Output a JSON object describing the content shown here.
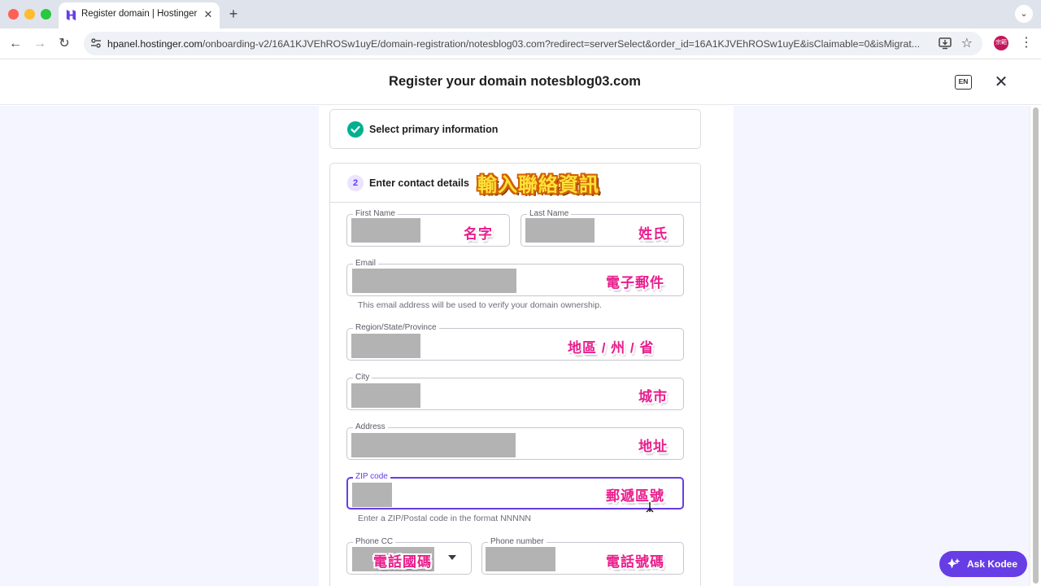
{
  "browser": {
    "tab_title": "Register domain | Hostinger",
    "tab_close": "✕",
    "new_tab": "+",
    "url_host": "hpanel.hostinger.com",
    "url_path": "/onboarding-v2/16A1KJVEhROSw1uyE/domain-registration/notesblog03.com?redirect=serverSelect&order_id=16A1KJVEhROSw1uyE&isClaimable=0&isMigrat...",
    "profile_initials": "宗範"
  },
  "header": {
    "title": "Register your domain notesblog03.com",
    "lang_label": "EN",
    "close_label": "✕"
  },
  "steps": {
    "step1": {
      "title": "Select primary information",
      "status": "complete"
    },
    "step2": {
      "number": "2",
      "title": "Enter contact details"
    }
  },
  "annotations": {
    "contact_details": "輸入聯絡資訊",
    "first_name": "名字",
    "last_name": "姓氏",
    "email": "電子郵件",
    "region": "地區 / 州 / 省",
    "city": "城市",
    "address": "地址",
    "zip": "郵遞區號",
    "phone_cc": "電話國碼",
    "phone_number": "電話號碼"
  },
  "form": {
    "first_name_label": "First Name",
    "last_name_label": "Last Name",
    "email_label": "Email",
    "email_hint": "This email address will be used to verify your domain ownership.",
    "region_label": "Region/State/Province",
    "city_label": "City",
    "address_label": "Address",
    "zip_label": "ZIP code",
    "zip_hint": "Enter a ZIP/Postal code in the format NNNNN",
    "phone_cc_label": "Phone CC",
    "phone_number_label": "Phone number"
  },
  "assistant": {
    "label": "Ask Kodee"
  },
  "colors": {
    "brand": "#673de6",
    "success": "#00b090",
    "annotation_pink": "#e91e8c",
    "annotation_orange": "#ffe23a"
  }
}
